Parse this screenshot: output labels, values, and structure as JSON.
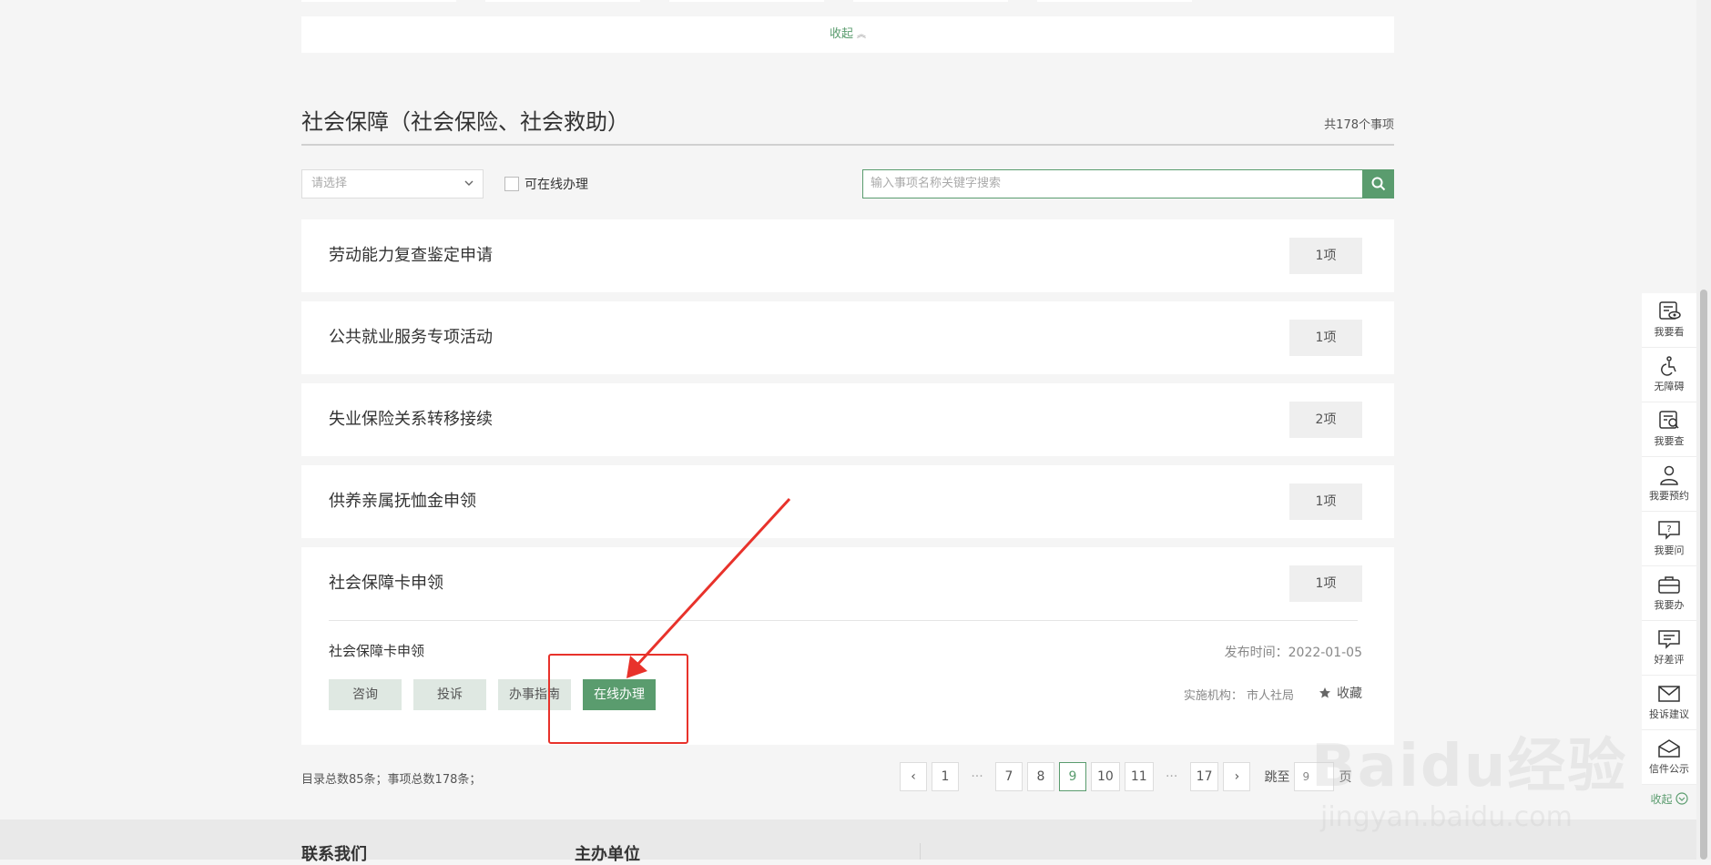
{
  "collapse_bar": {
    "label": "收起"
  },
  "section": {
    "title": "社会保障（社会保险、社会救助）",
    "count": "共178个事项"
  },
  "filters": {
    "select_placeholder": "请选择",
    "online_only_label": "可在线办理",
    "search_placeholder": "输入事项名称关键字搜索"
  },
  "items": [
    {
      "name": "劳动能力复查鉴定申请",
      "count": "1项"
    },
    {
      "name": "公共就业服务专项活动",
      "count": "1项"
    },
    {
      "name": "失业保险关系转移接续",
      "count": "2项"
    },
    {
      "name": "供养亲属抚恤金申领",
      "count": "1项"
    }
  ],
  "expanded_item": {
    "name": "社会保障卡申领",
    "count": "1项",
    "sub_name": "社会保障卡申领",
    "pubdate": "发布时间：2022-01-05",
    "actions": [
      "咨询",
      "投诉",
      "办事指南",
      "在线办理"
    ],
    "org": "实施机构：  市人社局",
    "favorite": "收藏"
  },
  "totals": "目录总数85条；事项总数178条；",
  "pagination": {
    "prev": "‹",
    "pages": [
      "1",
      "7",
      "8",
      "9",
      "10",
      "11",
      "17"
    ],
    "ellipsis": "···",
    "next": "›",
    "current": "9",
    "jump_label": "跳至",
    "jump_value": "9",
    "page_unit": "页"
  },
  "footer": {
    "contact": "联系我们",
    "organizer": "主办单位"
  },
  "side_rail": {
    "items": [
      {
        "label": "我要看",
        "icon": "eye-icon"
      },
      {
        "label": "无障碍",
        "icon": "accessibility-icon"
      },
      {
        "label": "我要查",
        "icon": "search-doc-icon"
      },
      {
        "label": "我要预约",
        "icon": "user-icon"
      },
      {
        "label": "我要问",
        "icon": "question-icon"
      },
      {
        "label": "我要办",
        "icon": "briefcase-icon"
      },
      {
        "label": "好差评",
        "icon": "comment-icon"
      },
      {
        "label": "投诉建议",
        "icon": "mail-icon"
      },
      {
        "label": "信件公示",
        "icon": "open-mail-icon"
      }
    ],
    "collapse": "收起"
  },
  "watermark": {
    "brand": "Baidu经验",
    "url": "jingyan.baidu.com"
  },
  "colors": {
    "accent": "#5a9c6e",
    "annotation": "#e8322b"
  }
}
